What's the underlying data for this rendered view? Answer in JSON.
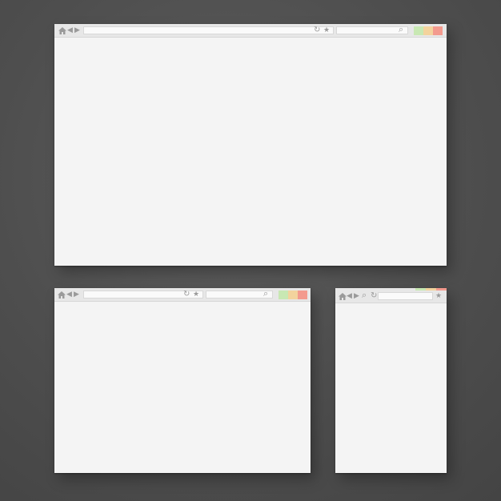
{
  "colors": {
    "background": "#4f4f4f",
    "window": "#f3f3f3",
    "titlebar": "#e7e7e7",
    "icon": "#9a9a9a",
    "minimize": "#c8e8b3",
    "maximize": "#f3d39d",
    "close": "#f39a8e"
  },
  "icons": {
    "home": "home-icon",
    "back": "◀",
    "forward": "▶",
    "reload": "↻",
    "star": "★",
    "search": "⌕"
  },
  "windows": {
    "large": {},
    "medium": {},
    "small": {}
  }
}
